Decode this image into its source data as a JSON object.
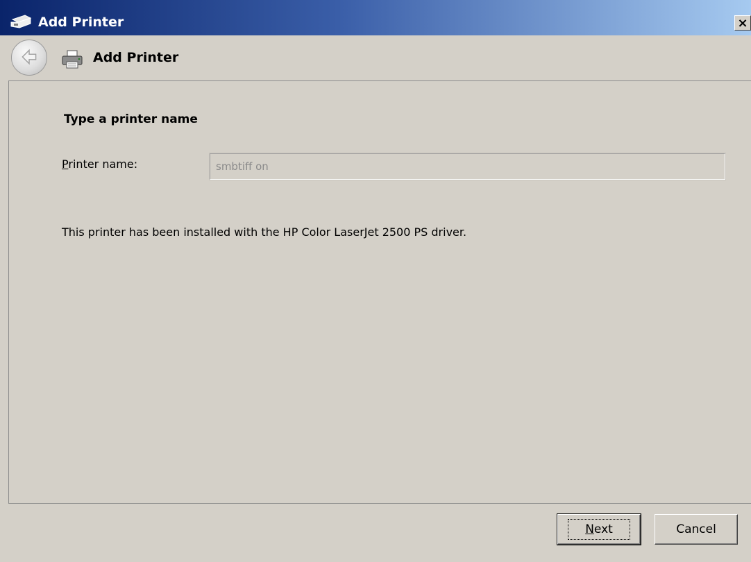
{
  "window": {
    "title": "Add Printer",
    "close_label": "×"
  },
  "header": {
    "title": "Add Printer"
  },
  "content": {
    "heading": "Type a printer name",
    "printer_name_label_mnemonic": "P",
    "printer_name_label_rest": "rinter name:",
    "printer_name_value": "smbtiff on",
    "info": "This printer has been installed with the HP Color LaserJet 2500 PS driver."
  },
  "footer": {
    "next_mnemonic": "N",
    "next_rest": "ext",
    "cancel_label": "Cancel"
  },
  "icons": {
    "title": "printer-icon",
    "back": "back-arrow-icon",
    "header": "printer-icon",
    "close": "close-icon"
  },
  "colors": {
    "titlebar_start": "#0a246a",
    "titlebar_end": "#a6caf0",
    "face": "#d4d0c8"
  }
}
